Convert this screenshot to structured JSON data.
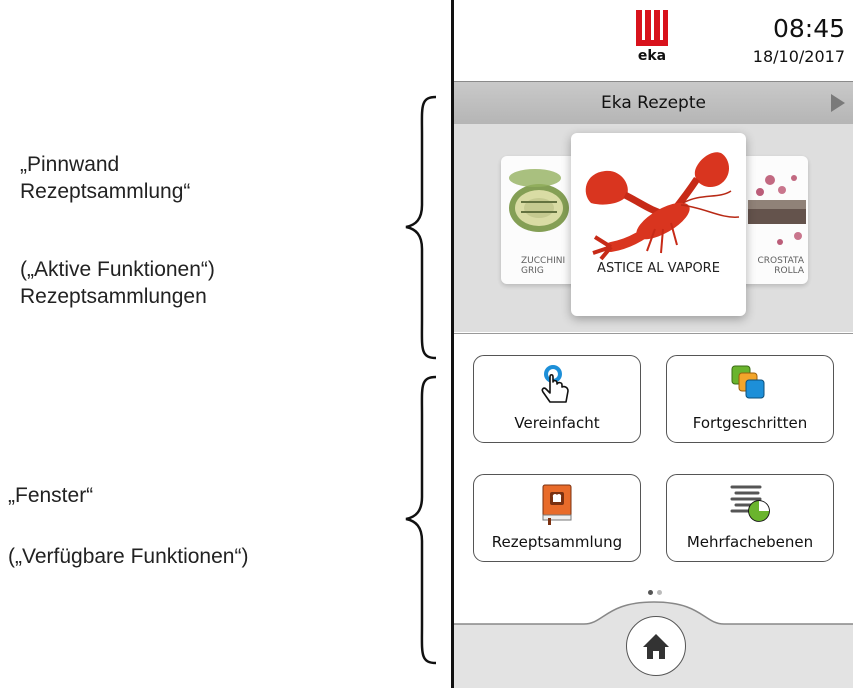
{
  "annotations": {
    "top_title": "„Pinnwand\nRezeptsammlung“",
    "top_subtitle": "(„Aktive Funktionen“)\nRezeptsammlungen",
    "bottom_title": "„Fenster“",
    "bottom_subtitle": "(„Verfügbare Funktionen“)"
  },
  "header": {
    "logo_text": "eka",
    "time": "08:45",
    "date": "18/10/2017"
  },
  "titlebar": {
    "title": "Eka Rezepte"
  },
  "carousel": {
    "left_label": "ZUCCHINI\nGRIG",
    "center_label": "ASTICE AL VAPORE",
    "right_label": "CROSTATA\nROLLA"
  },
  "tiles": [
    {
      "label": "Vereinfacht",
      "icon": "hand-pointer-icon"
    },
    {
      "label": "Fortgeschritten",
      "icon": "stacked-squares-icon"
    },
    {
      "label": "Rezeptsammlung",
      "icon": "recipe-book-icon"
    },
    {
      "label": "Mehrfachebenen",
      "icon": "multi-level-timer-icon"
    }
  ],
  "pager": {
    "pages": 2,
    "active": 1
  },
  "home": {
    "icon": "home-icon"
  },
  "colors": {
    "brand_red": "#d8121c",
    "titlebar": "#bdbdbd",
    "carousel_bg": "#dedede",
    "accent_blue": "#1d8fd8",
    "accent_green": "#6ab42d",
    "accent_orange": "#e86b2a"
  }
}
